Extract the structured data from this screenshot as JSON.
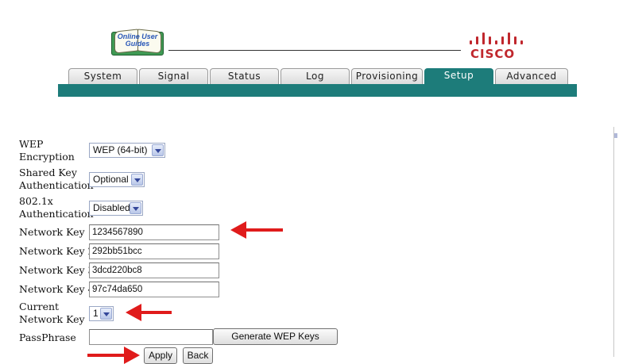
{
  "header": {
    "guide_logo_text": "Online User Guides",
    "brand": "CISCO",
    "brand_color": "#c0272d",
    "accent_color": "#1d7c7a"
  },
  "tabs": [
    {
      "label": "System",
      "active": false
    },
    {
      "label": "Signal",
      "active": false
    },
    {
      "label": "Status",
      "active": false
    },
    {
      "label": "Log",
      "active": false
    },
    {
      "label": "Provisioning",
      "active": false
    },
    {
      "label": "Setup",
      "active": true
    },
    {
      "label": "Advanced",
      "active": false
    }
  ],
  "form": {
    "wep_encryption": {
      "label_line1": "WEP",
      "label_line2": "Encryption",
      "value": "WEP (64-bit)"
    },
    "shared_key_auth": {
      "label_line1": "Shared Key",
      "label_line2": "Authentication",
      "value": "Optional"
    },
    "dot1x_auth": {
      "label_line1": "802.1x",
      "label_line2": "Authentication",
      "value": "Disabled"
    },
    "network_keys": [
      {
        "label": "Network Key 1",
        "value": "1234567890"
      },
      {
        "label": "Network Key 2",
        "value": "292bb51bcc"
      },
      {
        "label": "Network Key 3",
        "value": "3dcd220bc8"
      },
      {
        "label": "Network Key 4",
        "value": "97c74da650"
      }
    ],
    "current_key": {
      "label_line1": "Current",
      "label_line2": "Network Key",
      "value": "1"
    },
    "passphrase": {
      "label": "PassPhrase",
      "value": ""
    },
    "generate_button": "Generate WEP Keys",
    "apply_button": "Apply",
    "back_button": "Back"
  },
  "annotations": {
    "arrow_color": "#e01b1b",
    "arrows": [
      "pointing-to-network-key-1",
      "pointing-to-current-network-key",
      "pointing-to-apply-button"
    ]
  }
}
